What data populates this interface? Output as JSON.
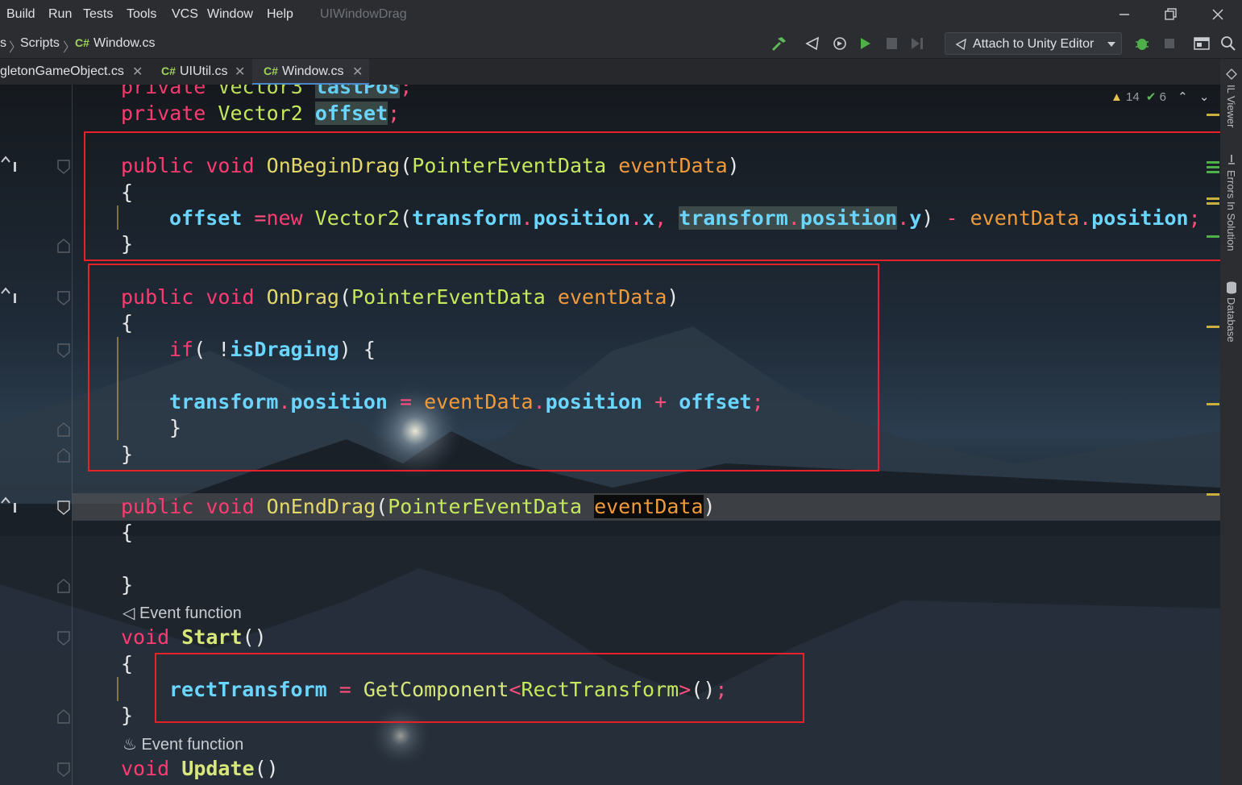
{
  "menu": {
    "items": [
      "Build",
      "Run",
      "Tests",
      "Tools",
      "VCS",
      "Window",
      "Help"
    ],
    "project": "UIWindowDrag"
  },
  "nav": {
    "breadcrumb_prefix": "s",
    "breadcrumb": [
      "Scripts",
      "Window.cs"
    ],
    "attach_label": "Attach to Unity Editor"
  },
  "tabs": [
    {
      "label": "gletonGameObject.cs",
      "lang": ""
    },
    {
      "label": "UIUtil.cs",
      "lang": "C#"
    },
    {
      "label": "Window.cs",
      "lang": "C#",
      "active": true
    }
  ],
  "inspection": {
    "warnings": "14",
    "ok": "6"
  },
  "right_panel": [
    "IL Viewer",
    "Errors In Solution",
    "Database"
  ],
  "code": {
    "line_partial": "private Vector3 lastPos;",
    "field_offset": "private Vector2 offset;",
    "on_begin_drag": {
      "sig": "public void OnBeginDrag(PointerEventData eventData)",
      "open": "{",
      "body": "offset =new Vector2(transform.position.x, transform.position.y) - eventData.position;",
      "close": "}"
    },
    "on_drag": {
      "sig": "public void OnDrag(PointerEventData eventData)",
      "open": "{",
      "if": "if( !isDraging) {",
      "body": "transform.position = eventData.position + offset;",
      "inner_close": "}",
      "close": "}"
    },
    "on_end_drag": {
      "sig": "public void OnEndDrag(PointerEventData eventData)",
      "open": "{",
      "close": "}"
    },
    "hint_event": "Event function",
    "start": {
      "sig": "void Start()",
      "open": "{",
      "body": "rectTransform = GetComponent<RectTransform>();",
      "close": "}"
    },
    "hint_event2": "Event function",
    "update": {
      "sig": "void Update()"
    }
  }
}
